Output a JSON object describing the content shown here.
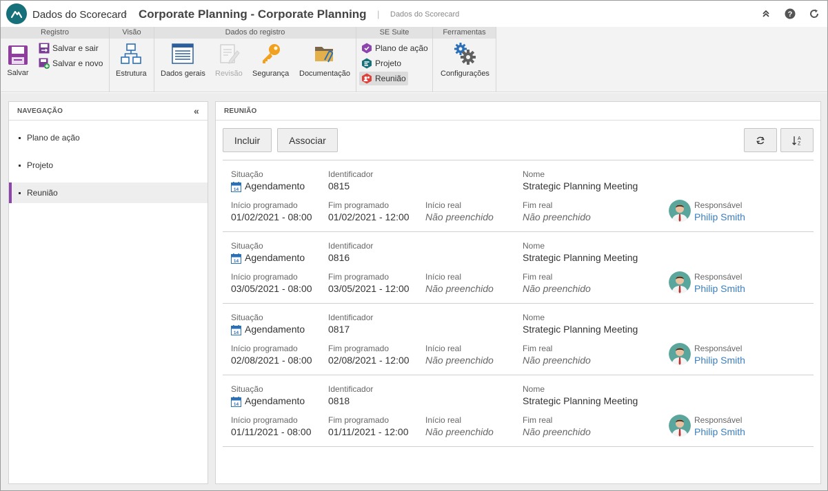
{
  "titlebar": {
    "app_name": "Dados do Scorecard",
    "title": "Corporate Planning - Corporate Planning",
    "subtitle": "Dados do Scorecard"
  },
  "ribbon": {
    "groups": {
      "registro": "Registro",
      "visao": "Visão",
      "dados": "Dados do registro",
      "suite": "SE Suite",
      "ferramentas": "Ferramentas"
    },
    "salvar": "Salvar",
    "salvar_sair": "Salvar e sair",
    "salvar_novo": "Salvar e novo",
    "estrutura": "Estrutura",
    "dados_gerais": "Dados gerais",
    "revisao": "Revisão",
    "seguranca": "Segurança",
    "documentacao": "Documentação",
    "plano_acao": "Plano de ação",
    "projeto": "Projeto",
    "reuniao": "Reunião",
    "configuracoes": "Configurações"
  },
  "nav": {
    "title": "NAVEGAÇÃO",
    "items": [
      "Plano de ação",
      "Projeto",
      "Reunião"
    ],
    "selected_index": 2
  },
  "main": {
    "title": "REUNIÃO",
    "incluir": "Incluir",
    "associar": "Associar"
  },
  "labels": {
    "situacao": "Situação",
    "identificador": "Identificador",
    "nome": "Nome",
    "inicio_programado": "Início programado",
    "fim_programado": "Fim programado",
    "inicio_real": "Início real",
    "fim_real": "Fim real",
    "responsavel": "Responsável"
  },
  "records": [
    {
      "situacao": "Agendamento",
      "id": "0815",
      "nome": "Strategic Planning Meeting",
      "inicio_prog": "01/02/2021 - 08:00",
      "fim_prog": "01/02/2021 - 12:00",
      "inicio_real": "Não preenchido",
      "fim_real": "Não preenchido",
      "responsavel": "Philip Smith"
    },
    {
      "situacao": "Agendamento",
      "id": "0816",
      "nome": "Strategic Planning Meeting",
      "inicio_prog": "03/05/2021 - 08:00",
      "fim_prog": "03/05/2021 - 12:00",
      "inicio_real": "Não preenchido",
      "fim_real": "Não preenchido",
      "responsavel": "Philip Smith"
    },
    {
      "situacao": "Agendamento",
      "id": "0817",
      "nome": "Strategic Planning Meeting",
      "inicio_prog": "02/08/2021 - 08:00",
      "fim_prog": "02/08/2021 - 12:00",
      "inicio_real": "Não preenchido",
      "fim_real": "Não preenchido",
      "responsavel": "Philip Smith"
    },
    {
      "situacao": "Agendamento",
      "id": "0818",
      "nome": "Strategic Planning Meeting",
      "inicio_prog": "01/11/2021 - 08:00",
      "fim_prog": "01/11/2021 - 12:00",
      "inicio_real": "Não preenchido",
      "fim_real": "Não preenchido",
      "responsavel": "Philip Smith"
    }
  ],
  "colors": {
    "accent": "#8e44ad",
    "link": "#3a7fbf",
    "brand": "#16707a"
  }
}
